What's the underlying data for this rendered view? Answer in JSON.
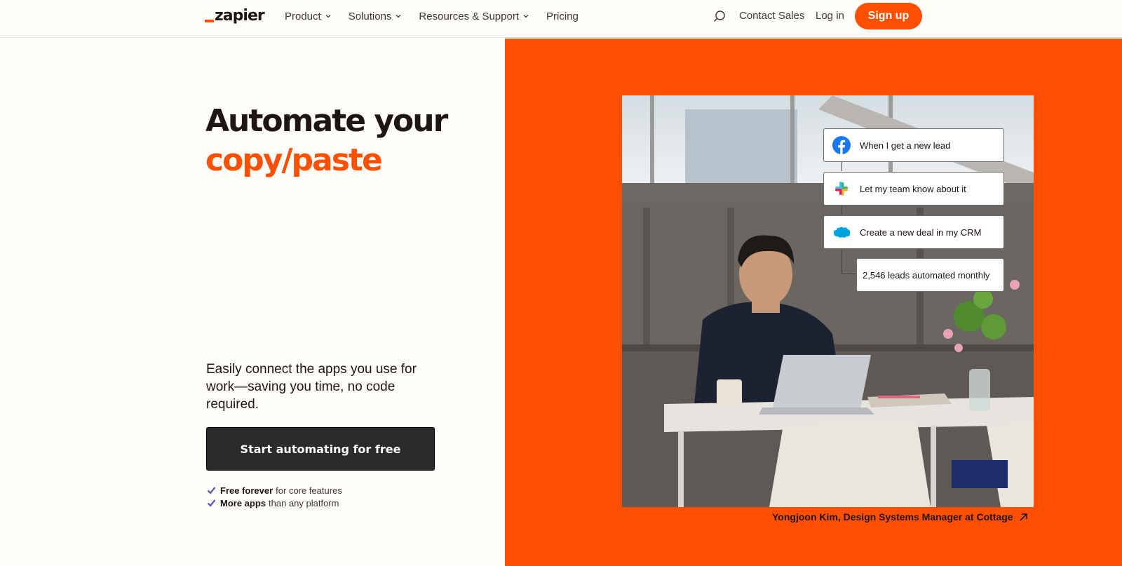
{
  "header": {
    "logo_text": "zapier",
    "nav": [
      {
        "label": "Product",
        "has_dropdown": true
      },
      {
        "label": "Solutions",
        "has_dropdown": true
      },
      {
        "label": "Resources & Support",
        "has_dropdown": true
      },
      {
        "label": "Pricing",
        "has_dropdown": false
      }
    ],
    "search_icon": "search-icon",
    "contact_label": "Contact Sales",
    "login_label": "Log in",
    "signup_label": "Sign up"
  },
  "hero": {
    "title_line1": "Automate your",
    "title_line2": "copy/paste",
    "subtitle": "Easily connect the apps you use for work—saving you time, no code required.",
    "cta_label": "Start automating for free",
    "perks": [
      {
        "bold": "Free forever",
        "rest": "for core features"
      },
      {
        "bold": "More apps",
        "rest": "than any platform"
      }
    ]
  },
  "workflow": {
    "steps": [
      {
        "icon": "facebook-icon",
        "label": "When I get a new lead"
      },
      {
        "icon": "slack-icon",
        "label": "Let my team know about it"
      },
      {
        "icon": "salesforce-icon",
        "label": "Create a new deal in my CRM"
      }
    ],
    "result_label": "2,546 leads automated monthly"
  },
  "caption": "Yongjoon Kim, Design Systems Manager at Cottage",
  "colors": {
    "brand_orange": "#ff4f00",
    "dark_text": "#201515",
    "background": "#fffdf9",
    "cta_bg": "#2b2b2b",
    "check_purple": "#5b4ec9"
  }
}
